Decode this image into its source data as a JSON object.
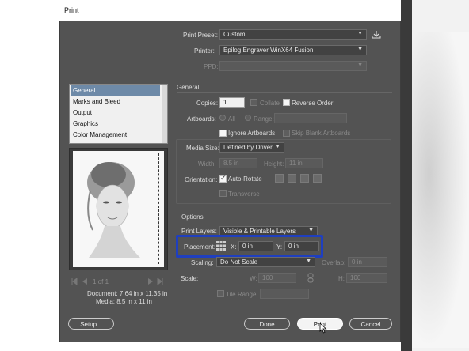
{
  "window": {
    "title": "Print"
  },
  "top": {
    "preset_label": "Print Preset:",
    "preset_value": "Custom",
    "printer_label": "Printer:",
    "printer_value": "Epilog Engraver WinX64 Fusion",
    "ppd_label": "PPD:"
  },
  "sidebar": {
    "items": [
      {
        "label": "General",
        "selected": true
      },
      {
        "label": "Marks and Bleed"
      },
      {
        "label": "Output"
      },
      {
        "label": "Graphics"
      },
      {
        "label": "Color Management"
      }
    ]
  },
  "preview": {
    "page_info": "1 of 1",
    "document_label": "Document: 7.64 in x 11.35 in",
    "media_label": "Media: 8.5 in x 11 in"
  },
  "general": {
    "heading": "General",
    "copies_label": "Copies:",
    "copies_value": "1",
    "collate_label": "Collate",
    "reverse_order_label": "Reverse Order",
    "artboards_label": "Artboards:",
    "all_label": "All",
    "range_label": "Range:",
    "ignore_artboards_label": "Ignore Artboards",
    "skip_blank_label": "Skip Blank Artboards",
    "media_size_label": "Media Size:",
    "media_size_value": "Defined by Driver",
    "width_label": "Width:",
    "width_value": "8.5 in",
    "height_label": "Height:",
    "height_value": "11 in",
    "orientation_label": "Orientation:",
    "auto_rotate_label": "Auto-Rotate",
    "transverse_label": "Transverse"
  },
  "options": {
    "heading": "Options",
    "print_layers_label": "Print Layers:",
    "print_layers_value": "Visible & Printable Layers",
    "placement_label": "Placement:",
    "x_label": "X:",
    "x_value": "0 in",
    "y_label": "Y:",
    "y_value": "0 in",
    "scaling_label": "Scaling:",
    "scaling_value": "Do Not Scale",
    "overlap_label": "Overlap:",
    "overlap_value": "0 in",
    "scale_label": "Scale:",
    "scale_w_label": "W:",
    "scale_w_value": "100",
    "scale_h_label": "H:",
    "scale_h_value": "100",
    "tile_range_label": "Tile Range:"
  },
  "buttons": {
    "setup": "Setup...",
    "done": "Done",
    "print": "Print",
    "cancel": "Cancel"
  },
  "colors": {
    "dialog_bg": "#535353",
    "highlight": "#1f3fbf",
    "selection": "#6e8aa8"
  }
}
